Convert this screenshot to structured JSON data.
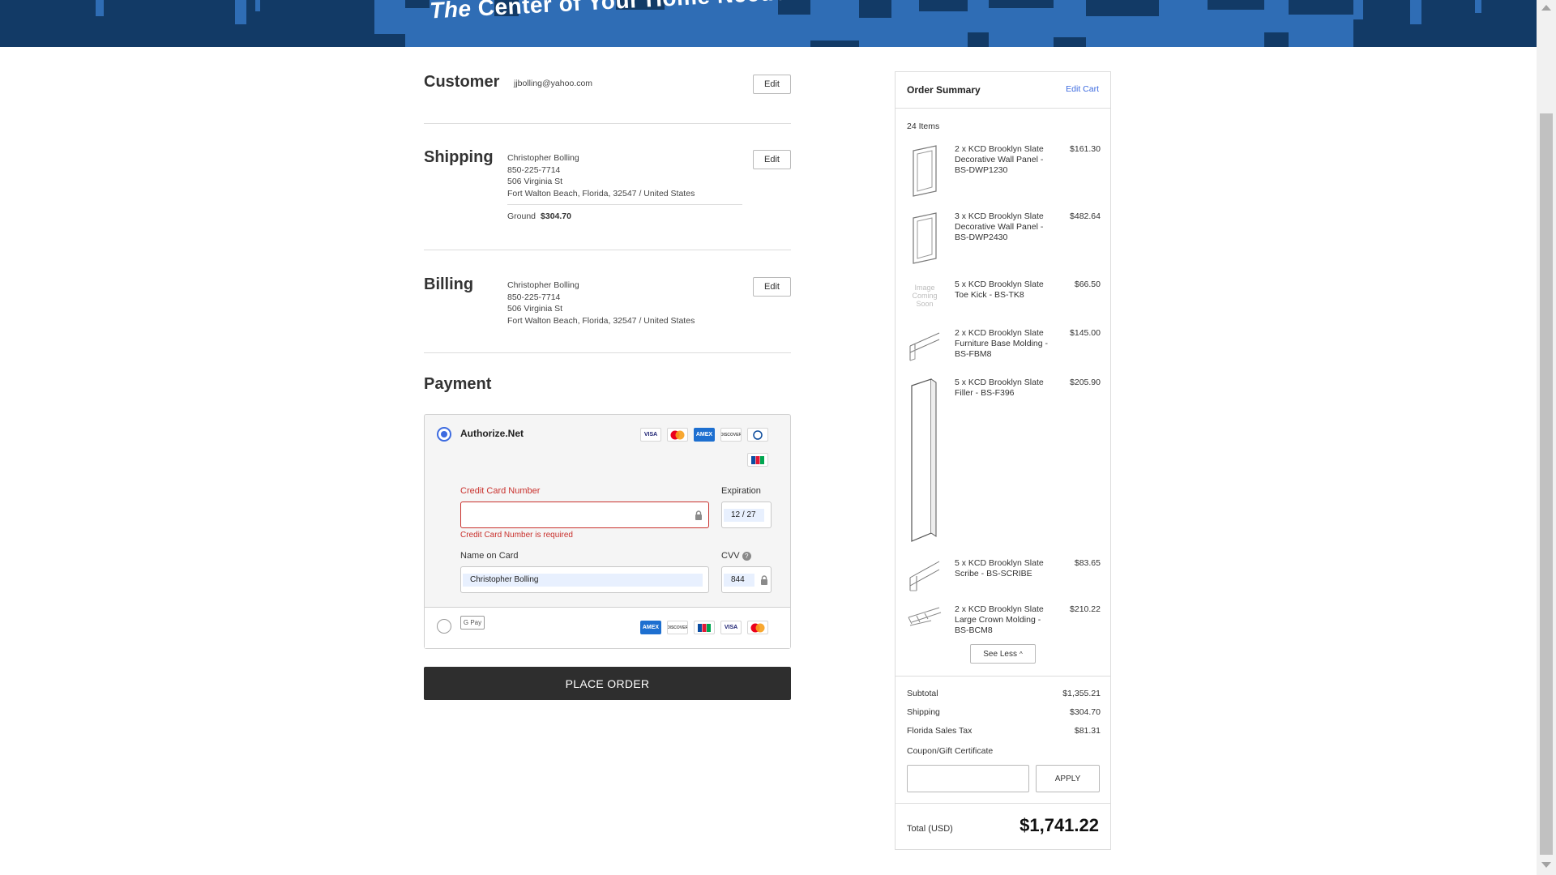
{
  "banner": {
    "title_prefix": "The",
    "title_main": "Center of Your Home Needs"
  },
  "customer": {
    "title": "Customer",
    "email": "jjbolling@yahoo.com",
    "edit_label": "Edit"
  },
  "shipping": {
    "title": "Shipping",
    "edit_label": "Edit",
    "name": "Christopher Bolling",
    "phone": "850-225-7714",
    "street": "506 Virginia St",
    "city_line": "Fort Walton Beach, Florida, 32547 / United States",
    "method": "Ground",
    "method_price": "$304.70"
  },
  "billing": {
    "title": "Billing",
    "edit_label": "Edit",
    "name": "Christopher Bolling",
    "phone": "850-225-7714",
    "street": "506 Virginia St",
    "city_line": "Fort Walton Beach, Florida, 32547 / United States"
  },
  "payment": {
    "title": "Payment",
    "authorize": {
      "label": "Authorize.Net",
      "selected": true,
      "cards": [
        "VISA",
        "MC",
        "AMEX",
        "DISCOVER",
        "DINERS",
        "JCB"
      ],
      "cc_label": "Credit Card Number",
      "cc_value": "",
      "cc_error": "Credit Card Number is required",
      "exp_label": "Expiration",
      "exp_value": "12 / 27",
      "name_label": "Name on Card",
      "name_value": "Christopher Bolling",
      "cvv_label": "CVV",
      "cvv_value": "844"
    },
    "gpay": {
      "label": "G Pay",
      "selected": false,
      "cards": [
        "AMEX",
        "DISCOVER",
        "JCB",
        "VISA",
        "MC"
      ]
    },
    "place_order_label": "PLACE ORDER"
  },
  "summary": {
    "title": "Order Summary",
    "edit_cart": "Edit Cart",
    "items_count": "24 Items",
    "items": [
      {
        "name": "2 x KCD Brooklyn Slate Decorative Wall Panel - BS-DWP1230",
        "price": "$161.30",
        "thumb": "panel-icon"
      },
      {
        "name": "3 x KCD Brooklyn Slate Decorative Wall Panel - BS-DWP2430",
        "price": "$482.64",
        "thumb": "panel-icon"
      },
      {
        "name": "5 x KCD Brooklyn Slate Toe Kick - BS-TK8",
        "price": "$66.50",
        "thumb": "image-coming-soon",
        "thumb_text": [
          "Image",
          "Coming",
          "Soon"
        ]
      },
      {
        "name": "2 x KCD Brooklyn Slate Furniture Base Molding - BS-FBM8",
        "price": "$145.00",
        "thumb": "molding-icon"
      },
      {
        "name": "5 x KCD Brooklyn Slate Filler - BS-F396",
        "price": "$205.90",
        "thumb": "filler-icon"
      },
      {
        "name": "5 x KCD Brooklyn Slate Scribe - BS-SCRIBE",
        "price": "$83.65",
        "thumb": "scribe-icon"
      },
      {
        "name": "2 x KCD Brooklyn Slate Large Crown Molding - BS-BCM8",
        "price": "$210.22",
        "thumb": "crown-icon"
      }
    ],
    "see_less": "See Less",
    "subtotal_label": "Subtotal",
    "subtotal": "$1,355.21",
    "shipping_label": "Shipping",
    "shipping": "$304.70",
    "tax_label": "Florida Sales Tax",
    "tax": "$81.31",
    "coupon_label": "Coupon/Gift Certificate",
    "coupon_value": "",
    "apply_label": "APPLY",
    "total_label": "Total (USD)",
    "total": "$1,741.22"
  },
  "colors": {
    "banner": "#123a66",
    "accent": "#3d6be0",
    "error": "#c9302c",
    "button_dark": "#2e2e2e"
  }
}
